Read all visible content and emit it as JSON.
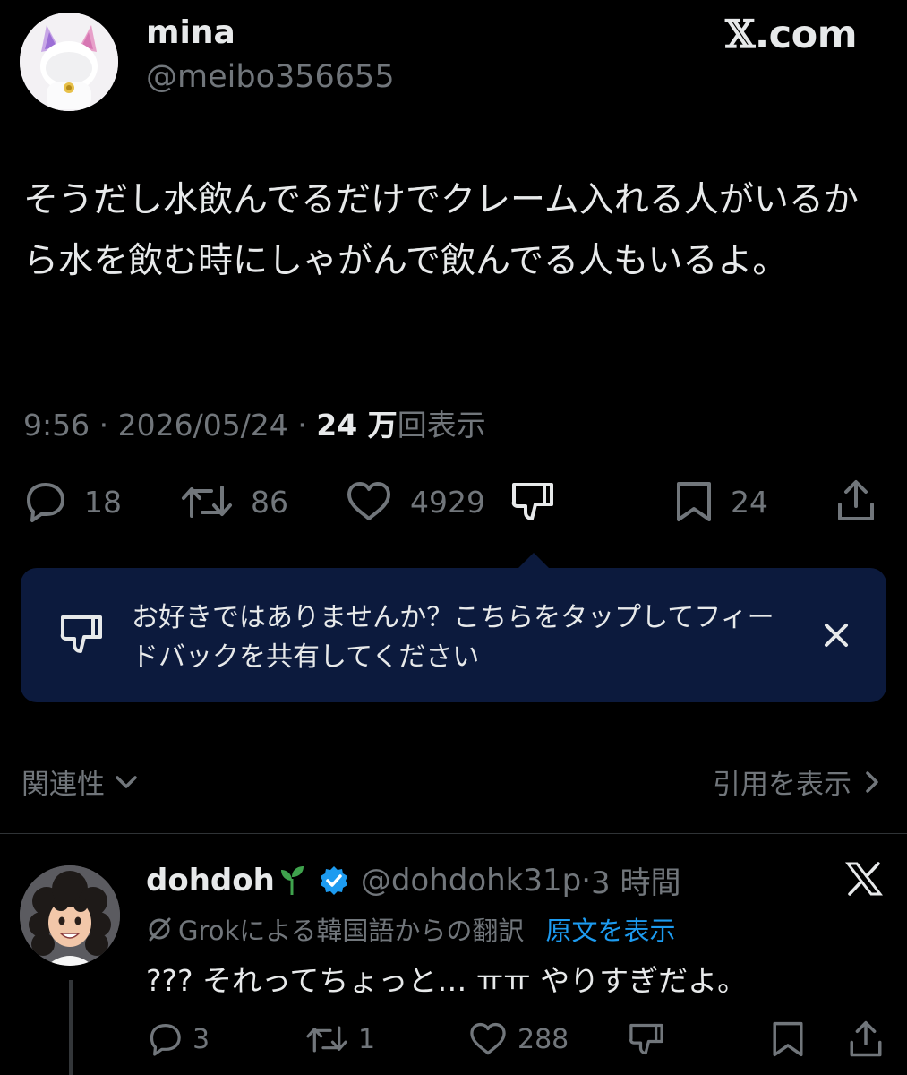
{
  "tweet": {
    "author": {
      "display_name": "mina",
      "handle": "@meibo356655"
    },
    "brand": {
      "x_mark": "𝕏",
      "domain": ".com"
    },
    "text": "そうだし水飲んでるだけでクレーム入れる人がいるから水を飲む時にしゃがんで飲んでる人もいるよ。",
    "meta": {
      "time": "9:56",
      "separator": " · ",
      "date": "2026/05/24",
      "views_number": "24 万",
      "views_label": "回表示"
    },
    "actions": {
      "replies": "18",
      "reposts": "86",
      "likes": "4929",
      "bookmarks": "24"
    }
  },
  "feedback_banner": {
    "text": "お好きではありませんか？こちらをタップしてフィードバックを共有してください"
  },
  "sort": {
    "relevance_label": "関連性",
    "quotes_label": "引用を表示"
  },
  "reply": {
    "display_name": "dohdoh",
    "handle": "@dohdohk31p",
    "separator": "·",
    "time": "3 時間",
    "translation_note": "Grokによる韓国語からの翻訳",
    "show_original": "原文を表示",
    "text": "??? それってちょっと… ㅠㅠ やりすぎだよ。",
    "actions": {
      "replies": "3",
      "reposts": "1",
      "likes": "288"
    }
  },
  "colors": {
    "background": "#000000",
    "text": "#e7e9ea",
    "muted": "#71767b",
    "banner": "#0c1a3d",
    "link": "#1d9bf0",
    "verified": "#1d9bf0",
    "sprout": "#3fa34d"
  },
  "icons": [
    "reply-icon",
    "repost-icon",
    "like-icon",
    "dislike-icon",
    "bookmark-icon",
    "share-icon",
    "close-icon",
    "chevron-down-icon",
    "chevron-right-icon",
    "verified-icon",
    "sprout-icon",
    "x-logo-icon",
    "grok-icon"
  ]
}
